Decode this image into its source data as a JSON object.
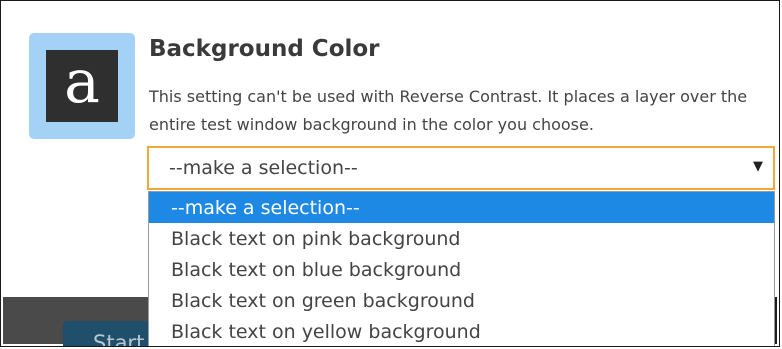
{
  "panel": {
    "logo_letter": "a",
    "title": "Background Color",
    "description": "This setting can't be used with Reverse Contrast. It places a layer over the entire test window background in the color you choose."
  },
  "select": {
    "value": "--make a selection--",
    "caret": "▼",
    "options": [
      "--make a selection--",
      "Black text on pink background",
      "Black text on blue background",
      "Black text on green background",
      "Black text on yellow background"
    ],
    "highlighted_index": 0
  },
  "background": {
    "button_label_partial": "Start"
  },
  "colors": {
    "accent_focus": "#f2a93b",
    "highlight": "#1e88e5",
    "logo_tile": "#a3d2f6",
    "start_button": "#1f4f6b"
  },
  "icons": {
    "logo": "letter-a-icon",
    "caret": "chevron-down-icon"
  }
}
